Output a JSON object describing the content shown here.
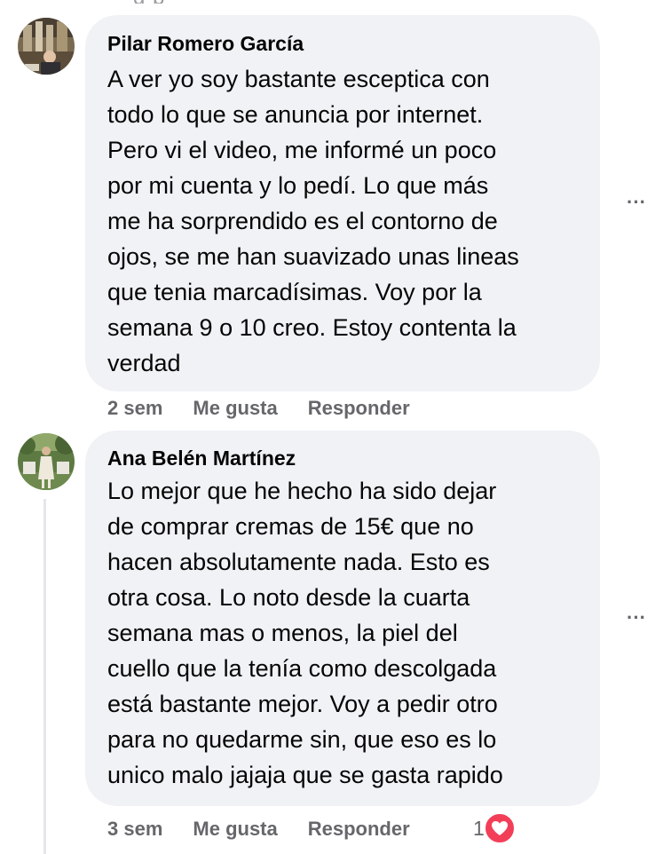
{
  "top_cut_text": "g  p",
  "comments": [
    {
      "author": "Pilar Romero García",
      "text": "A ver yo soy bastante esceptica con\ntodo lo que se anuncia por internet.\nPero vi el video, me informé un poco\npor mi cuenta y lo pedí. Lo que más\nme ha sorprendido es el contorno de\nojos, se me han suavizado unas lineas\nque tenia marcadísimas. Voy por la\nsemana 9 o 10 creo. Estoy contenta la\nverdad",
      "time": "2 sem",
      "like_label": "Me gusta",
      "reply_label": "Responder",
      "more_label": "···"
    },
    {
      "author": "Ana Belén Martínez",
      "text": "Lo mejor que he hecho ha sido dejar\nde comprar cremas de 15€ que no\nhacen absolutamente nada. Esto es\notra cosa. Lo noto desde la cuarta\nsemana mas o menos, la piel del\ncuello que la tenía como descolgada\nestá bastante mejor. Voy a pedir otro\npara no quedarme sin, que eso es lo\nunico malo jajaja que se gasta rapido",
      "time": "3 sem",
      "like_label": "Me gusta",
      "reply_label": "Responder",
      "more_label": "···",
      "reaction_count": "1",
      "reaction_icon": "heart-icon"
    }
  ],
  "colors": {
    "bubble": "#f0f2f5",
    "meta": "#65676b",
    "heart": "#f33e58"
  }
}
